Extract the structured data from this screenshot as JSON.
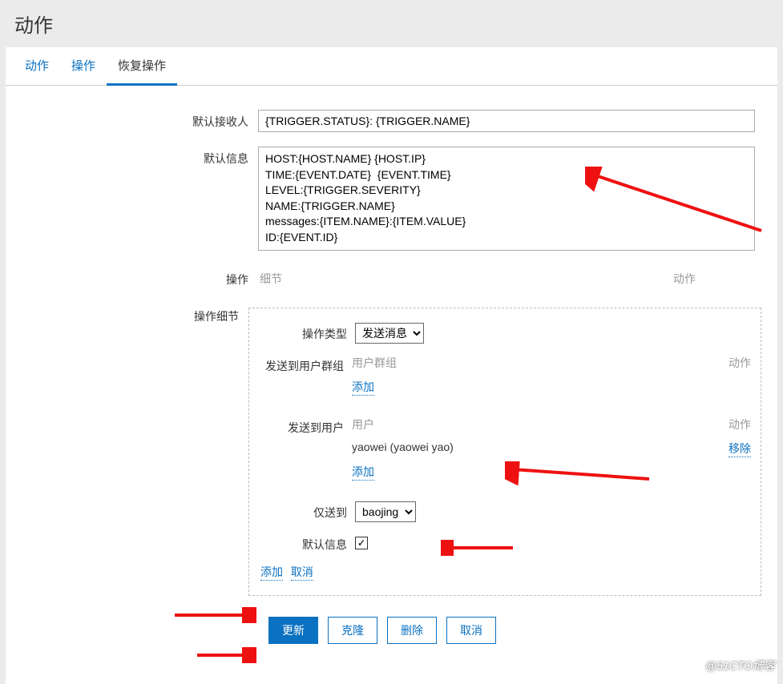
{
  "header": {
    "title": "动作"
  },
  "tabs": {
    "items": [
      {
        "label": "动作",
        "active": false
      },
      {
        "label": "操作",
        "active": false
      },
      {
        "label": "恢复操作",
        "active": true
      }
    ]
  },
  "form": {
    "default_recipient": {
      "label": "默认接收人",
      "value": "{TRIGGER.STATUS}: {TRIGGER.NAME}"
    },
    "default_message": {
      "label": "默认信息",
      "value": "HOST:{HOST.NAME} {HOST.IP}\nTIME:{EVENT.DATE}  {EVENT.TIME}\nLEVEL:{TRIGGER.SEVERITY}\nNAME:{TRIGGER.NAME}\nmessages:{ITEM.NAME}:{ITEM.VALUE}\nID:{EVENT.ID}"
    },
    "operations": {
      "label": "操作",
      "columns": {
        "detail": "细节",
        "action": "动作"
      }
    },
    "operation_detail": {
      "label": "操作细节",
      "type": {
        "label": "操作类型",
        "value": "发送消息"
      },
      "send_to_groups": {
        "label": "发送到用户群组",
        "columns": {
          "name": "用户群组",
          "action": "动作"
        },
        "rows": [],
        "add": "添加"
      },
      "send_to_users": {
        "label": "发送到用户",
        "columns": {
          "name": "用户",
          "action": "动作"
        },
        "rows": [
          {
            "name": "yaowei (yaowei yao)",
            "action": "移除"
          }
        ],
        "add": "添加"
      },
      "only_send_to": {
        "label": "仅送到",
        "value": "baojing"
      },
      "default_info": {
        "label": "默认信息",
        "checked": true
      },
      "actions": {
        "add": "添加",
        "cancel": "取消"
      }
    }
  },
  "buttons": {
    "update": "更新",
    "clone": "克隆",
    "delete": "删除",
    "cancel": "取消"
  },
  "watermark": "@51CTO博客"
}
